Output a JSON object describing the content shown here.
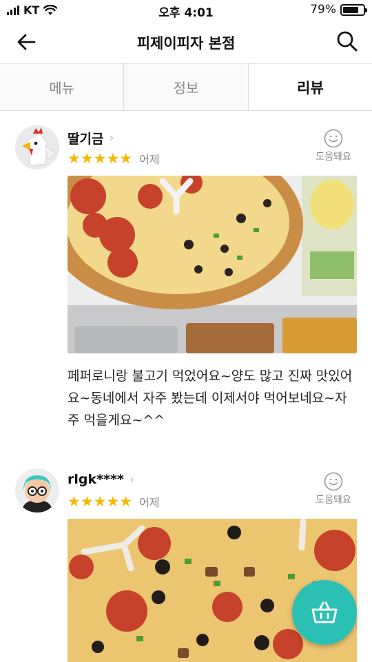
{
  "status_bar": {
    "carrier": "KT",
    "time": "오후 4:01",
    "battery_text": "79%",
    "battery_level": 0.79
  },
  "header": {
    "title": "피제이피자 본점",
    "back_icon": "arrow-left-icon",
    "search_icon": "search-icon"
  },
  "tabs": [
    {
      "label": "메뉴",
      "selected": false
    },
    {
      "label": "정보",
      "selected": false
    },
    {
      "label": "리뷰",
      "selected": true
    }
  ],
  "reviews": [
    {
      "author": "딸기금",
      "stars": "★★★★★",
      "rating": 5,
      "date": "어제",
      "helpful_label": "도움돼요",
      "text": "페퍼로니랑 불고기 먹었어요~양도 많고 진짜 맛있어요~동네에서 자주 봤는데 이제서야 먹어보네요~자주 먹을게요~^^"
    },
    {
      "author": "rlgk****",
      "stars": "★★★★★",
      "rating": 5,
      "date": "어제",
      "helpful_label": "도움돼요",
      "text": ""
    }
  ],
  "fab": {
    "icon": "basket-icon"
  },
  "colors": {
    "star": "#f8b800",
    "fab": "#2bc0b4"
  }
}
